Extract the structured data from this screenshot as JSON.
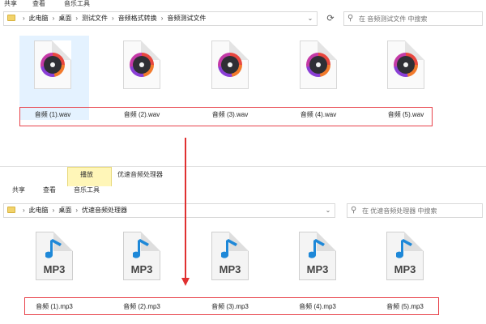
{
  "top_window": {
    "ribbon_tabs": [
      "共享",
      "查看",
      "音乐工具"
    ],
    "breadcrumb": [
      "此电脑",
      "桌面",
      "测试文件",
      "音频格式转换",
      "音频测试文件"
    ],
    "search_placeholder": "在 音频测试文件 中搜索",
    "files": [
      "音频 (1).wav",
      "音频 (2).wav",
      "音频 (3).wav",
      "音频 (4).wav",
      "音频 (5).wav"
    ]
  },
  "bottom_window": {
    "window_title": "优速音频处理器",
    "context_tab": "播放",
    "ribbon_tabs": [
      "共享",
      "查看",
      "音乐工具"
    ],
    "breadcrumb": [
      "此电脑",
      "桌面",
      "优速音频处理器"
    ],
    "search_placeholder": "在 优速音频处理器 中搜索",
    "files": [
      "音频 (1).mp3",
      "音频 (2).mp3",
      "音频 (3).mp3",
      "音频 (4).mp3",
      "音频 (5).mp3"
    ],
    "file_ext_label": "MP3"
  },
  "colors": {
    "selection": "#cde8ff",
    "red_box": "#e8424a",
    "arrow": "#e03030",
    "music_note": "#1e88d8"
  },
  "icons": {
    "wav": "music-disc-icon",
    "mp3": "mp3-file-icon"
  }
}
